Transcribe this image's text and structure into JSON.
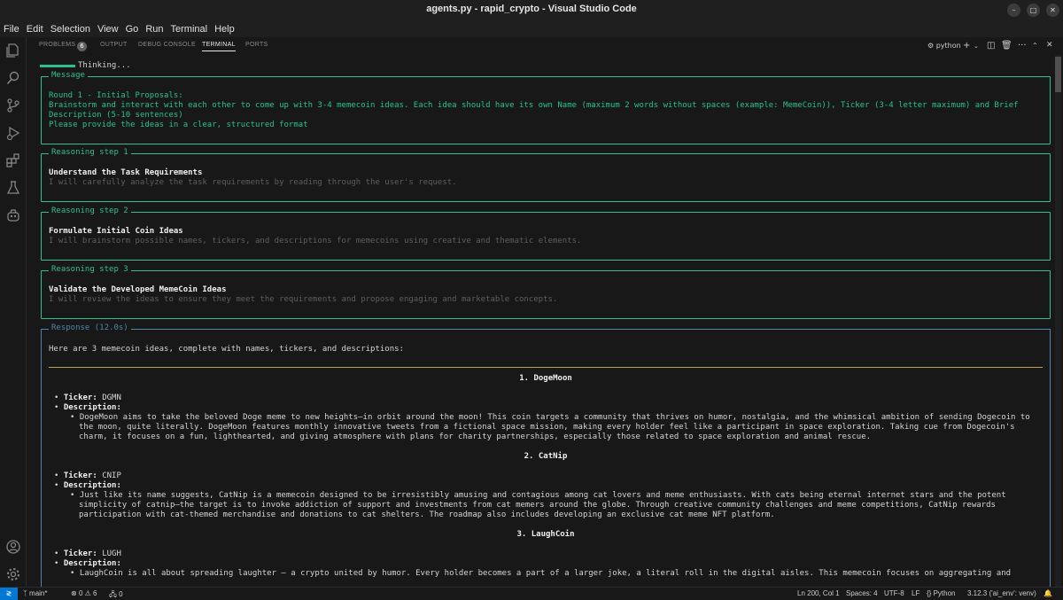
{
  "window": {
    "title": "agents.py - rapid_crypto - Visual Studio Code"
  },
  "menu": [
    "File",
    "Edit",
    "Selection",
    "View",
    "Go",
    "Run",
    "Terminal",
    "Help"
  ],
  "panel": {
    "tabs": [
      "PROBLEMS",
      "OUTPUT",
      "DEBUG CONSOLE",
      "TERMINAL",
      "PORTS"
    ],
    "problems_count": "6",
    "active_tab": "TERMINAL",
    "terminal_profile": "python"
  },
  "terminal": {
    "thinking": "Thinking...",
    "message": {
      "title": "Message",
      "lines": [
        "Round 1 - Initial Proposals:",
        "Brainstorm and interact with each other to come up with 3-4 memecoin ideas. Each idea should have its own Name (maximum 2 words without spaces (example: MemeCoin)), Ticker (3-4 letter maximum) and Brief",
        "Description (5-10 sentences)",
        "Please provide the ideas in a clear, structured format"
      ]
    },
    "steps": [
      {
        "title": "Reasoning step 1",
        "heading": "Understand the Task Requirements",
        "detail": "I will carefully analyze the task requirements by reading through the user's request."
      },
      {
        "title": "Reasoning step 2",
        "heading": "Formulate Initial Coin Ideas",
        "detail": "I will brainstorm possible names, tickers, and descriptions for memecoins using creative and thematic elements."
      },
      {
        "title": "Reasoning step 3",
        "heading": "Validate the Developed MemeCoin Ideas",
        "detail": "I will review the ideas to ensure they meet the requirements and propose engaging and marketable concepts."
      }
    ],
    "response": {
      "title": "Response (12.0s)",
      "intro": "Here are 3 memecoin ideas, complete with names, tickers, and descriptions:",
      "ticker_label": "Ticker:",
      "description_label": "Description:",
      "coins": [
        {
          "heading": "1. DogeMoon",
          "ticker": "DGMN",
          "desc": [
            "DogeMoon aims to take the beloved Doge meme to new heights—in orbit around the moon! This coin targets a community that thrives on humor, nostalgia, and the whimsical ambition of sending Dogecoin to",
            "the moon, quite literally. DogeMoon features monthly innovative tweets from a fictional space mission, making every holder feel like a participant in space exploration. Taking cue from Dogecoin's",
            "charm, it focuses on a fun, lighthearted, and giving atmosphere with plans for charity partnerships, especially those related to space exploration and animal rescue."
          ]
        },
        {
          "heading": "2. CatNip",
          "ticker": "CNIP",
          "desc": [
            "Just like its name suggests, CatNip is a memecoin designed to be irresistibly amusing and contagious among cat lovers and meme enthusiasts. With cats being eternal internet stars and the potent",
            "simplicity of catnip—the target is to invoke addiction of support and investments from cat memers around the globe. Through creative community challenges and meme competitions, CatNip rewards",
            "participation with cat-themed merchandise and donations to cat shelters. The roadmap also includes developing an exclusive cat meme NFT platform."
          ]
        },
        {
          "heading": "3. LaughCoin",
          "ticker": "LUGH",
          "desc": [
            "LaughCoin is all about spreading laughter — a crypto united by humor. Every holder becomes a part of a larger joke, a literal roll in the digital aisles. This memecoin focuses on aggregating and"
          ]
        }
      ]
    }
  },
  "statusbar": {
    "branch": "main*",
    "errors": "0",
    "warnings": "6",
    "ports": "0",
    "position": "Ln 200, Col 1",
    "spaces": "Spaces: 4",
    "encoding": "UTF-8",
    "eol": "LF",
    "language": "Python",
    "interpreter": "3.12.3 ('ai_env': venv)"
  }
}
